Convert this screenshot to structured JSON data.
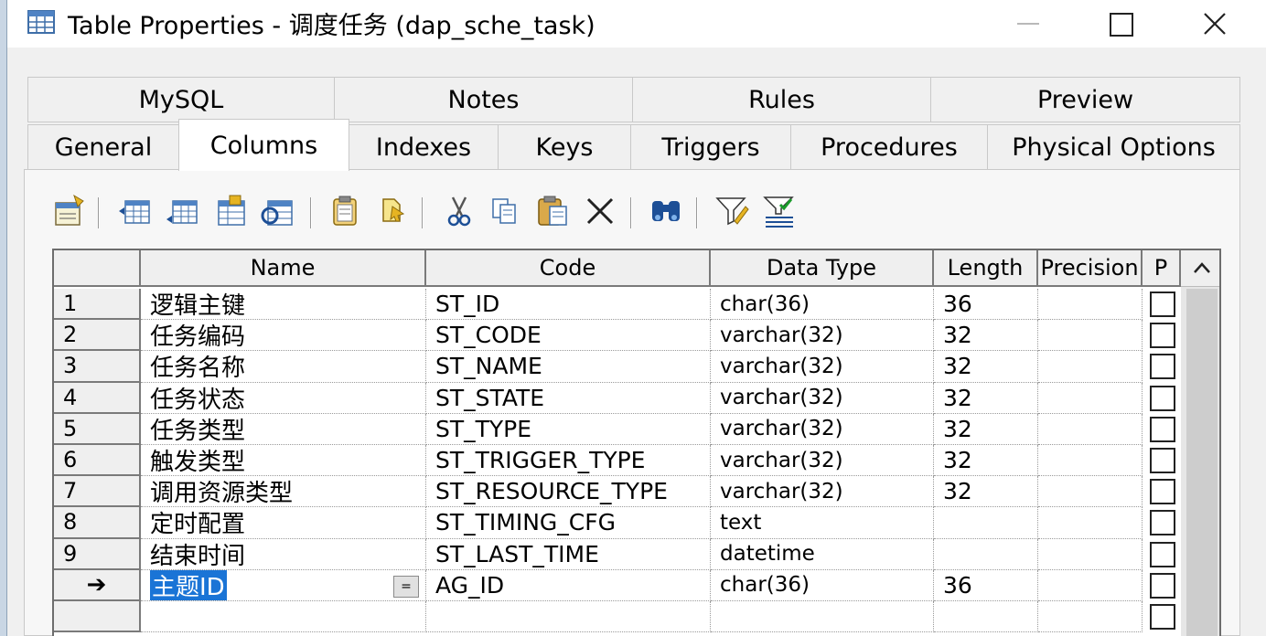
{
  "window": {
    "title": "Table Properties - 调度任务 (dap_sche_task)"
  },
  "tabs": {
    "row1": [
      {
        "label": "MySQL"
      },
      {
        "label": "Notes"
      },
      {
        "label": "Rules"
      },
      {
        "label": "Preview"
      }
    ],
    "row2": [
      {
        "label": "General"
      },
      {
        "label": "Columns"
      },
      {
        "label": "Indexes"
      },
      {
        "label": "Keys"
      },
      {
        "label": "Triggers"
      },
      {
        "label": "Procedures"
      },
      {
        "label": "Physical Options"
      }
    ],
    "active": "Columns"
  },
  "toolbar": {
    "icons": [
      "properties-icon",
      "insert-row-icon",
      "add-row-icon",
      "add-columns-icon",
      "reuse-columns-icon",
      "paste-icon",
      "new-item-icon",
      "cut-icon",
      "copy-icon",
      "paste-clipboard-icon",
      "delete-icon",
      "find-icon",
      "customize-columns-icon",
      "filter-icon"
    ]
  },
  "grid": {
    "headers": [
      "Name",
      "Code",
      "Data Type",
      "Length",
      "Precision",
      "P"
    ],
    "rows": [
      {
        "num": "1",
        "name": "逻辑主键",
        "code": "ST_ID",
        "type": "char(36)",
        "length": "36"
      },
      {
        "num": "2",
        "name": "任务编码",
        "code": "ST_CODE",
        "type": "varchar(32)",
        "length": "32"
      },
      {
        "num": "3",
        "name": "任务名称",
        "code": "ST_NAME",
        "type": "varchar(32)",
        "length": "32"
      },
      {
        "num": "4",
        "name": "任务状态",
        "code": "ST_STATE",
        "type": "varchar(32)",
        "length": "32"
      },
      {
        "num": "5",
        "name": "任务类型",
        "code": "ST_TYPE",
        "type": "varchar(32)",
        "length": "32"
      },
      {
        "num": "6",
        "name": "触发类型",
        "code": "ST_TRIGGER_TYPE",
        "type": "varchar(32)",
        "length": "32"
      },
      {
        "num": "7",
        "name": "调用资源类型",
        "code": "ST_RESOURCE_TYPE",
        "type": "varchar(32)",
        "length": "32"
      },
      {
        "num": "8",
        "name": "定时配置",
        "code": "ST_TIMING_CFG",
        "type": "text",
        "length": ""
      },
      {
        "num": "9",
        "name": "结束时间",
        "code": "ST_LAST_TIME",
        "type": "datetime",
        "length": ""
      },
      {
        "num": "➔",
        "name": "主题ID",
        "code": "AG_ID",
        "type": "char(36)",
        "length": "36"
      },
      {
        "num": "",
        "name": "",
        "code": "",
        "type": "",
        "length": ""
      }
    ],
    "edit_button_label": "="
  }
}
